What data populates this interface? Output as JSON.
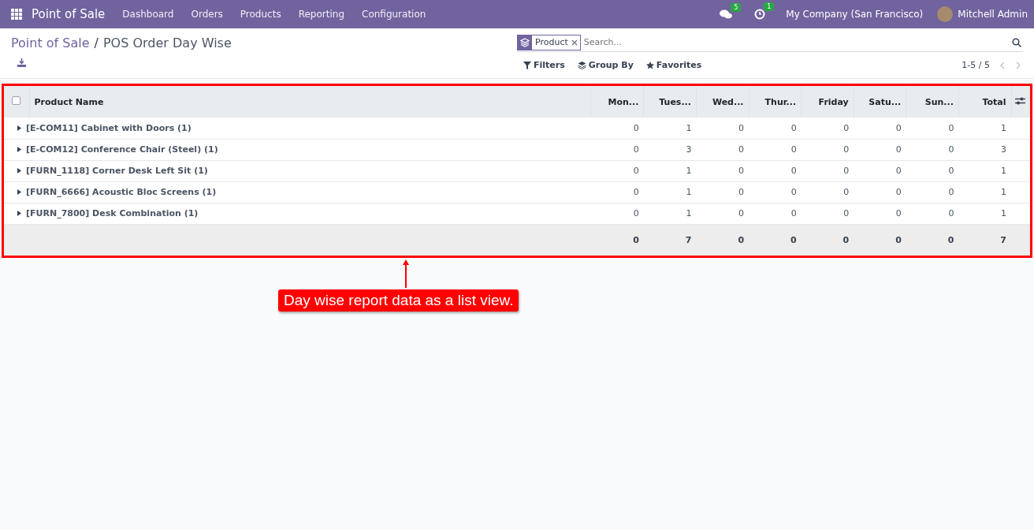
{
  "navbar": {
    "app_name": "Point of Sale",
    "menu": [
      "Dashboard",
      "Orders",
      "Products",
      "Reporting",
      "Configuration"
    ],
    "messages_count": "5",
    "activities_count": "1",
    "company": "My Company (San Francisco)",
    "user": "Mitchell Admin"
  },
  "breadcrumb": [
    "Point of Sale",
    "POS Order Day Wise"
  ],
  "breadcrumb_separator": "/",
  "search": {
    "facet": "Product",
    "placeholder": "Search..."
  },
  "search_options": [
    "Filters",
    "Group By",
    "Favorites"
  ],
  "pager": "1-5 / 5",
  "table": {
    "select_all_checked": false,
    "columns": [
      "Product Name",
      "Mon...",
      "Tues...",
      "Wed...",
      "Thur...",
      "Friday",
      "Satu...",
      "Sun...",
      "Total"
    ],
    "rows": [
      {
        "name": "[E-COM11] Cabinet with Doors (1)",
        "expanded": false,
        "values": [
          "0",
          "1",
          "0",
          "0",
          "0",
          "0",
          "0",
          "1"
        ]
      },
      {
        "name": "[E-COM12] Conference Chair (Steel) (1)",
        "expanded": false,
        "values": [
          "0",
          "3",
          "0",
          "0",
          "0",
          "0",
          "0",
          "3"
        ]
      },
      {
        "name": "[FURN_1118] Corner Desk Left Sit (1)",
        "expanded": false,
        "values": [
          "0",
          "1",
          "0",
          "0",
          "0",
          "0",
          "0",
          "1"
        ]
      },
      {
        "name": "[FURN_6666] Acoustic Bloc Screens (1)",
        "expanded": false,
        "values": [
          "0",
          "1",
          "0",
          "0",
          "0",
          "0",
          "0",
          "1"
        ]
      },
      {
        "name": "[FURN_7800] Desk Combination (1)",
        "expanded": false,
        "values": [
          "0",
          "1",
          "0",
          "0",
          "0",
          "0",
          "0",
          "1"
        ]
      }
    ],
    "totals": [
      "0",
      "7",
      "0",
      "0",
      "0",
      "0",
      "0",
      "7"
    ]
  },
  "annotation": "Day wise report data as a list view."
}
